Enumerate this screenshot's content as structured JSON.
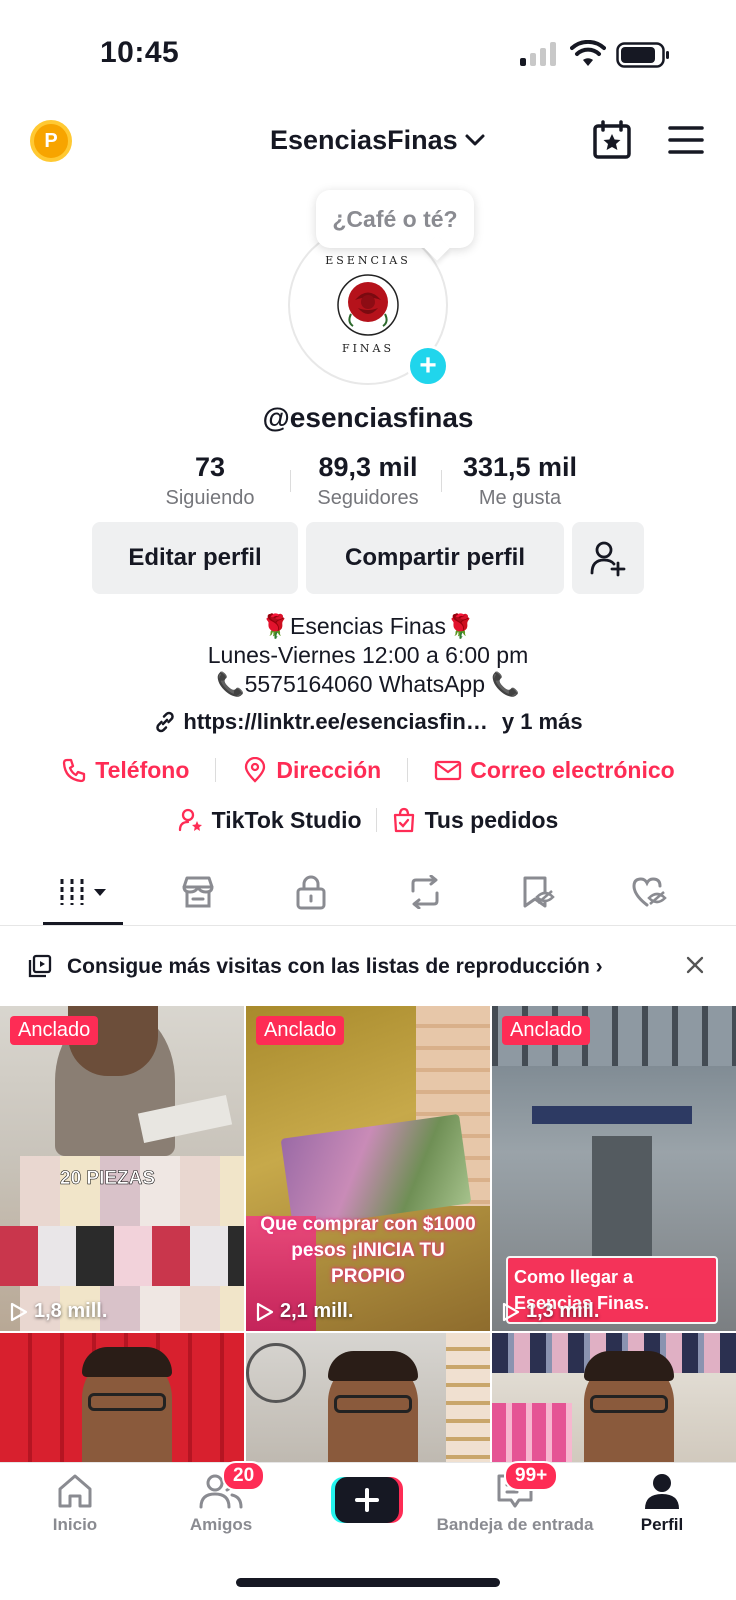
{
  "status_bar": {
    "time": "10:45"
  },
  "header": {
    "account_name": "EsenciasFinas"
  },
  "avatar": {
    "bubble_text": "¿Café o té?",
    "logo_text_top": "ESENCIAS",
    "logo_text_bottom": "FINAS"
  },
  "profile": {
    "username": "@esenciasfinas"
  },
  "stats": [
    {
      "value": "73",
      "label": "Siguiendo"
    },
    {
      "value": "89,3 mil",
      "label": "Seguidores"
    },
    {
      "value": "331,5 mil",
      "label": "Me gusta"
    }
  ],
  "buttons": {
    "edit": "Editar perfil",
    "share": "Compartir perfil"
  },
  "bio": {
    "line1": "🌹Esencias Finas🌹",
    "line2": "Lunes-Viernes 12:00 a 6:00 pm",
    "line3": "📞5575164060 WhatsApp 📞",
    "link": "https://linktr.ee/esenciasfin…",
    "link_more": "y 1 más"
  },
  "contacts": {
    "phone": "Teléfono",
    "address": "Dirección",
    "email": "Correo electrónico"
  },
  "tools": {
    "studio": "TikTok Studio",
    "orders": "Tus pedidos"
  },
  "banner": {
    "text": "Consigue más visitas con las listas de reproducción"
  },
  "videos": [
    {
      "pinned": "Anclado",
      "views": "1,8 mill.",
      "overlay": "20 PIEZAS"
    },
    {
      "pinned": "Anclado",
      "views": "2,1 mill.",
      "overlay": "Que comprar con $1000 pesos ¡INICIA TU PROPIO"
    },
    {
      "pinned": "Anclado",
      "views": "1,3 mill.",
      "overlay": "Como llegar a Esencias Finas."
    },
    {
      "pinned": "",
      "views": "",
      "overlay": ""
    },
    {
      "pinned": "",
      "views": "",
      "overlay": ""
    },
    {
      "pinned": "",
      "views": "",
      "overlay": ""
    }
  ],
  "bottom_nav": {
    "home": "Inicio",
    "friends": "Amigos",
    "friends_badge": "20",
    "inbox": "Bandeja de entrada",
    "inbox_badge": "99+",
    "profile": "Perfil"
  },
  "colors": {
    "accent": "#fe2c55",
    "teal": "#20d5ec",
    "coin": "#f7a400"
  }
}
